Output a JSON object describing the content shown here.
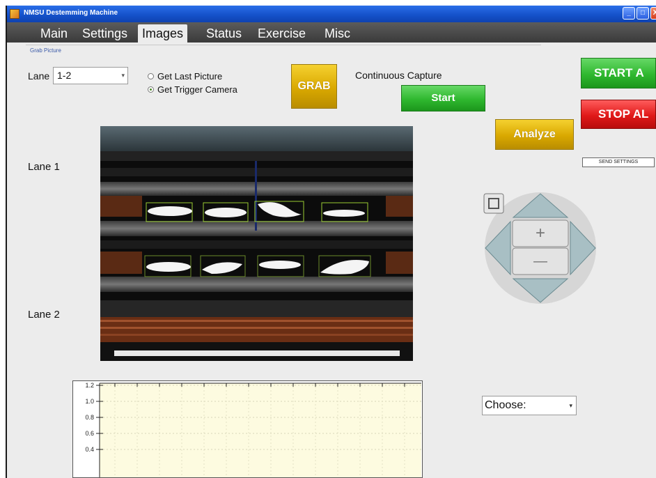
{
  "window": {
    "title": "NMSU Destemming Machine",
    "controls": [
      "_",
      "□",
      "X"
    ]
  },
  "menu": {
    "tabs": [
      "Main",
      "Settings",
      "Images",
      "Status",
      "Exercise",
      "Misc"
    ],
    "active_tab": "Images"
  },
  "grab": {
    "group_label": "Grab Picture",
    "lane_label": "Lane",
    "lane_value": "1-2",
    "radio_last": "Get Last Picture",
    "radio_trigger": "Get Trigger Camera",
    "selected_radio": "Get Trigger Camera",
    "grab_button": "GRAB",
    "continuous_label": "Continuous Capture",
    "start_button": "Start",
    "analyze_button": "Analyze"
  },
  "right_panel": {
    "start_all": "START A",
    "stop_all": "STOP AL",
    "send_settings": "SEND SETTINGS"
  },
  "lanes": {
    "lane1": "Lane 1",
    "lane2": "Lane 2"
  },
  "dpad": {
    "plus": "+",
    "minus": "—"
  },
  "choose": {
    "value": "Choose:"
  },
  "chart_data": {
    "type": "line",
    "yticks": [
      "1.2",
      "1.0",
      "0.8",
      "0.6",
      "0.4"
    ],
    "ylim": [
      0.4,
      1.2
    ],
    "grid": true,
    "series": []
  },
  "colors": {
    "menubar": "#3a3a3a",
    "gold": "#d9a800",
    "green": "#2fb82f",
    "red": "#e01818",
    "chart_bg": "#fdfbe0"
  }
}
